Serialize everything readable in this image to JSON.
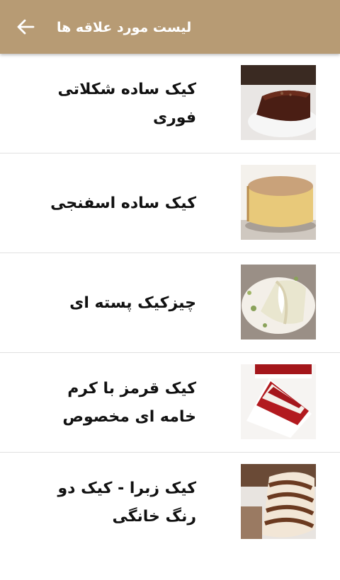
{
  "appbar": {
    "title": "لیست مورد علاقه ها",
    "back_icon": "arrow-left-icon",
    "color": "#b79b74"
  },
  "favorites": [
    {
      "label": "کیک ساده شکلاتی فوری",
      "image": "chocolate-cake-image"
    },
    {
      "label": "کیک ساده اسفنجی",
      "image": "sponge-cake-image"
    },
    {
      "label": "چیزکیک پسته ای",
      "image": "pistachio-cheesecake-image"
    },
    {
      "label": "کیک قرمز با کرم خامه ای مخصوص",
      "image": "red-velvet-cake-image"
    },
    {
      "label": "کیک زبرا - کیک دو رنگ خانگی",
      "image": "zebra-cake-image"
    }
  ]
}
